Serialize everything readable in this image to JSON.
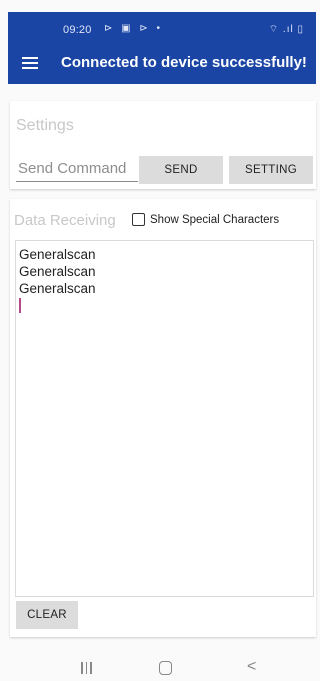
{
  "status_bar": {
    "time": "09:20",
    "left_icons": "⊳ ▣ ⊳ •",
    "right_icons": "⌔ .ıl ▯"
  },
  "app_bar": {
    "title": "Connected to device successfully!",
    "menu_icon": "hamburger-icon"
  },
  "settings_card": {
    "title": "Settings",
    "command_placeholder": "Send Command",
    "command_value": "",
    "send_label": "SEND",
    "setting_label": "SETTING"
  },
  "data_card": {
    "title": "Data Receiving",
    "show_special_label": "Show Special Characters",
    "show_special_checked": false,
    "received_lines": [
      "Generalscan",
      "Generalscan",
      "Generalscan"
    ],
    "clear_label": "CLEAR"
  },
  "nav_bar": {
    "recent_icon": "recent-apps-icon",
    "home_icon": "home-icon",
    "back_icon": "back-icon",
    "back_glyph": "<"
  },
  "colors": {
    "app_bar": "#1a45a5",
    "caret": "#b44a8a",
    "button_bg": "#dcdcdc"
  }
}
